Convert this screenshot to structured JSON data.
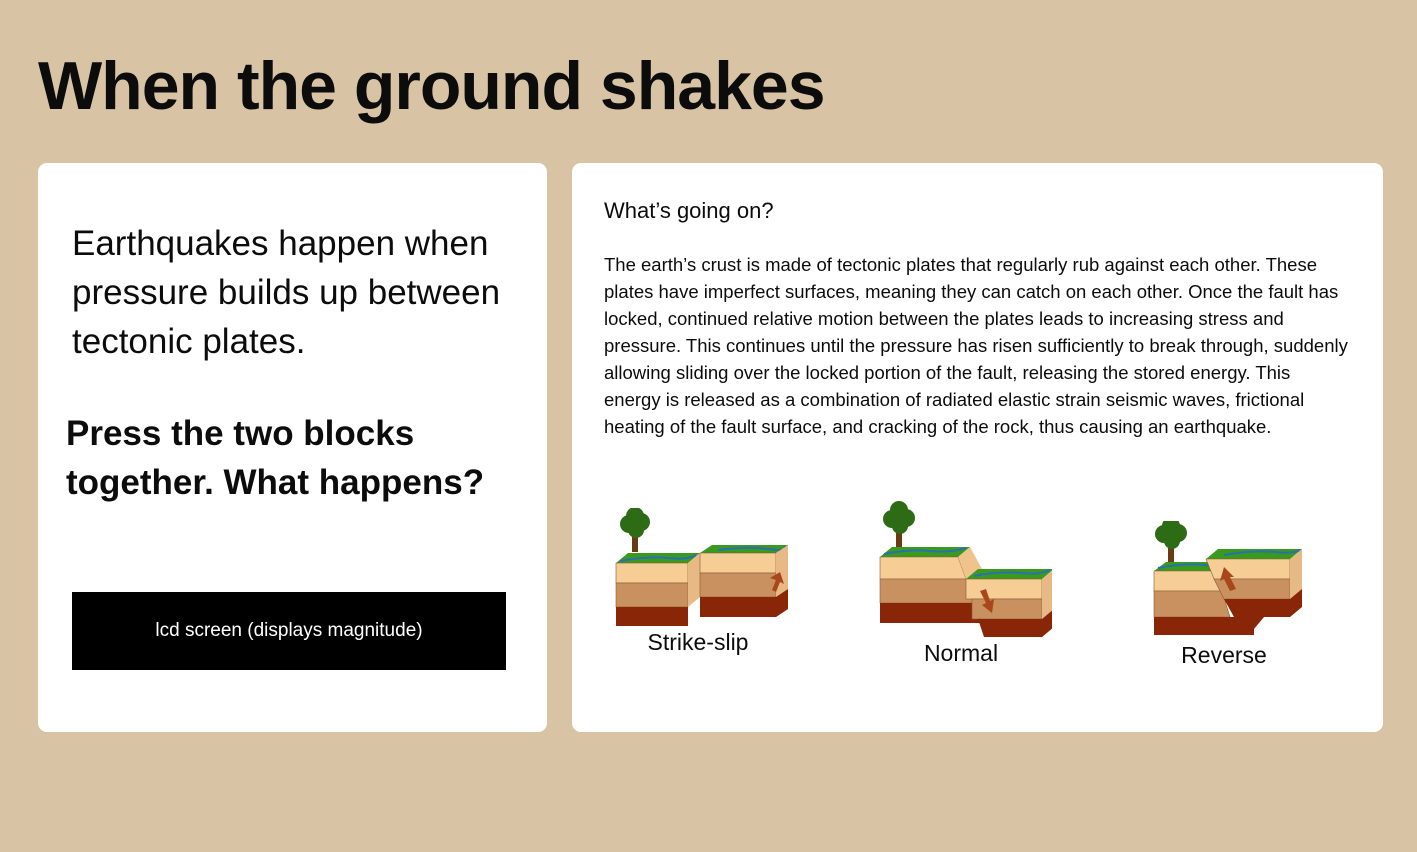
{
  "page": {
    "title": "When the ground shakes"
  },
  "left_card": {
    "intro": "Earthquakes happen when pressure builds up between tectonic plates.",
    "prompt": "Press the two blocks together. What happens?",
    "lcd_label": "lcd screen (displays magnitude)"
  },
  "right_card": {
    "heading": "What’s going on?",
    "body": "The earth’s crust is made of tectonic plates that regularly rub against each other. These plates have imperfect surfaces, meaning they can catch on each other. Once the fault has locked, continued relative motion between the plates leads to increasing stress and pressure. This continues until the pressure has risen sufficiently to break through, suddenly allowing sliding over the locked portion of the fault, releasing the stored energy. This energy is released as a combination of radiated elastic strain seismic waves, frictional heating of the fault surface, and cracking of the rock, thus causing an earthquake.",
    "faults": [
      {
        "label": "Strike-slip",
        "icon": "strike-slip-fault-icon"
      },
      {
        "label": "Normal",
        "icon": "normal-fault-icon"
      },
      {
        "label": "Reverse",
        "icon": "reverse-fault-icon"
      }
    ]
  },
  "colors": {
    "background": "#d9c3a5",
    "card": "#ffffff",
    "lcd": "#000000",
    "grass": "#3a9a1e",
    "topsoil": "#f7cd96",
    "midsoil": "#c99060",
    "bedrock": "#8a2608",
    "arrow": "#a9471c",
    "tree": "#2e6b15"
  }
}
